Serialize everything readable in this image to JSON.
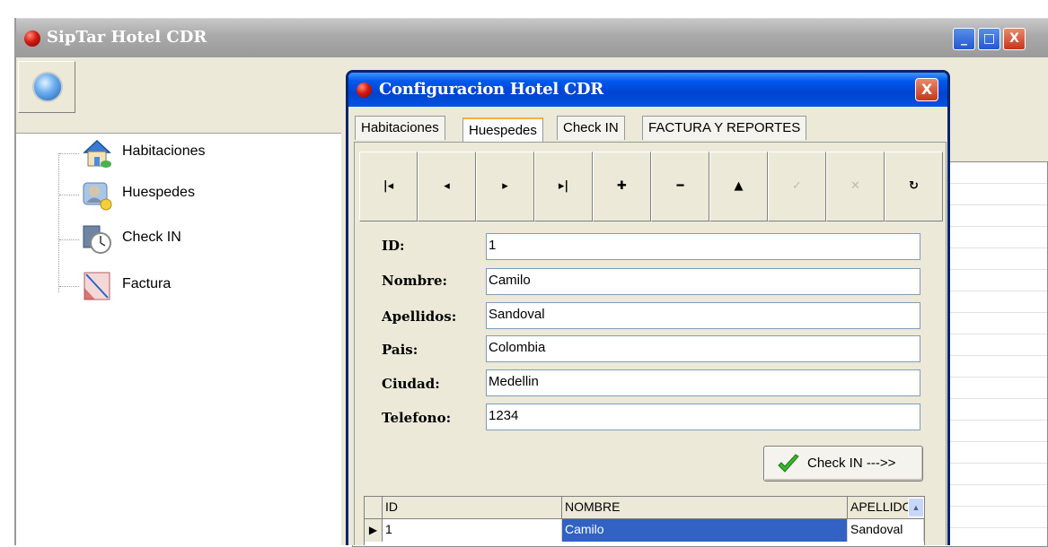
{
  "main_window": {
    "title": "SipTar Hotel CDR",
    "controls": {
      "minimize": "_",
      "maximize": "□",
      "close": "X"
    }
  },
  "tree": {
    "items": [
      {
        "label": "Habitaciones",
        "icon": "house-icon"
      },
      {
        "label": "Huespedes",
        "icon": "guest-icon"
      },
      {
        "label": "Check IN",
        "icon": "stopwatch-icon"
      },
      {
        "label": "Factura",
        "icon": "invoice-icon"
      }
    ]
  },
  "dialog": {
    "title": "Configuracion Hotel CDR",
    "close": "X",
    "tabs": [
      "Habitaciones",
      "Huespedes",
      "Check IN",
      "FACTURA Y REPORTES"
    ],
    "active_tab": "Huespedes",
    "navigator": {
      "first": "|◂",
      "prior": "◂",
      "next": "▸",
      "last": "▸|",
      "insert": "✚",
      "delete": "━",
      "edit": "▲",
      "post": "✓",
      "cancel": "✕",
      "refresh": "↻"
    },
    "fields": [
      {
        "label": "ID:",
        "value": "1"
      },
      {
        "label": "Nombre:",
        "value": "Camilo"
      },
      {
        "label": "Apellidos:",
        "value": "Sandoval"
      },
      {
        "label": "Pais:",
        "value": "Colombia"
      },
      {
        "label": "Ciudad:",
        "value": "Medellin"
      },
      {
        "label": "Telefono:",
        "value": "1234"
      }
    ],
    "checkin_button": "Check IN --->>",
    "grid": {
      "columns": [
        "ID",
        "NOMBRE",
        "APELLIDO"
      ],
      "rows": [
        {
          "id": "1",
          "nombre": "Camilo",
          "apellido": "Sandoval"
        }
      ],
      "row_indicator": "▶"
    }
  },
  "colors": {
    "xp_blue": "#0058ee",
    "selection": "#3162c4",
    "face": "#ece9d8"
  }
}
